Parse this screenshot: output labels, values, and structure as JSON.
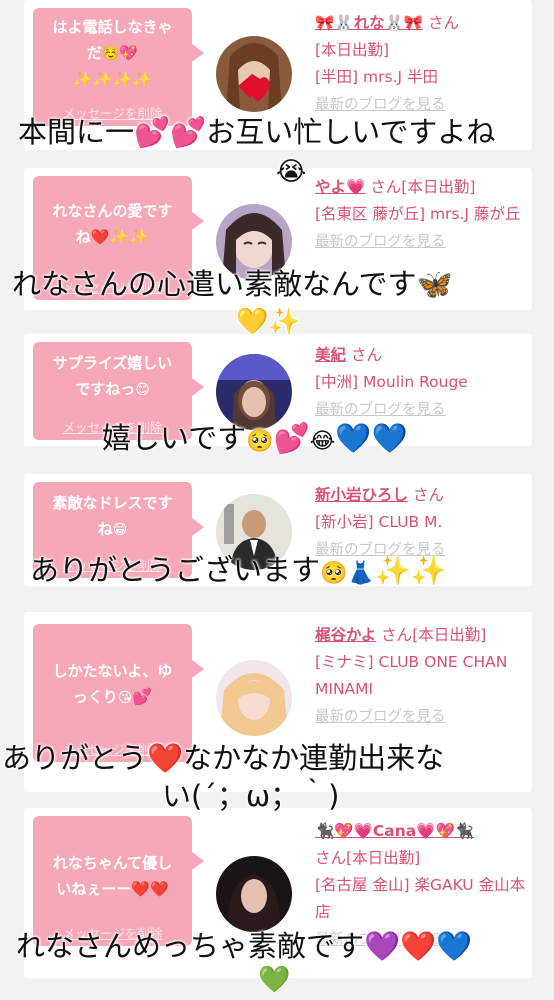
{
  "delete_label": "メッセージを削除",
  "blog_label": "最新のブログを見る",
  "san": "さん",
  "cards": [
    {
      "message": "はよ電話しなきゃだ☺️💖✨✨✨✨",
      "name": "🎀🐰れな🐰🎀",
      "status": "[本日出勤]",
      "store": "[半田] mrs.J 半田"
    },
    {
      "message": "れなさんの愛ですね❤️✨✨",
      "name": "やよ💗",
      "status": "[本日出勤]",
      "store": "[名東区 藤が丘] mrs.J 藤が丘"
    },
    {
      "message": "サプライズ嬉しいですねっ😊",
      "name": "美紀",
      "status": "",
      "store": "[中洲] Moulin Rouge"
    },
    {
      "message": "素敵なドレスですね😁",
      "name": "新小岩ひろし",
      "status": "",
      "store": "[新小岩] CLUB M."
    },
    {
      "message": "しかたないよ、ゆっくり😘💕",
      "name": "梶谷かよ",
      "status": "[本日出勤]",
      "store": "[ミナミ] CLUB ONE CHAN MINAMI"
    },
    {
      "message": "れなちゃんて優しいねぇーー❤️❤️",
      "name": "🐈‍⬛💖💗Cana💗💖🐈‍⬛",
      "status": "[本日出勤]",
      "store": "[名古屋 金山] 楽GAKU 金山本店"
    }
  ],
  "overlays": [
    "本間に一💕💕お互い忙しいですよね😭",
    "れなさんの心遣い素敵なんです🦋💛✨",
    "嬉しいです🥺💕😂💙💙",
    "ありがとうございます🥺👗✨✨",
    "ありがとう❤️なかなか連勤出来ない(´；ω；｀)",
    "れなさんめっちゃ素敵です💜❤️💙💚"
  ]
}
